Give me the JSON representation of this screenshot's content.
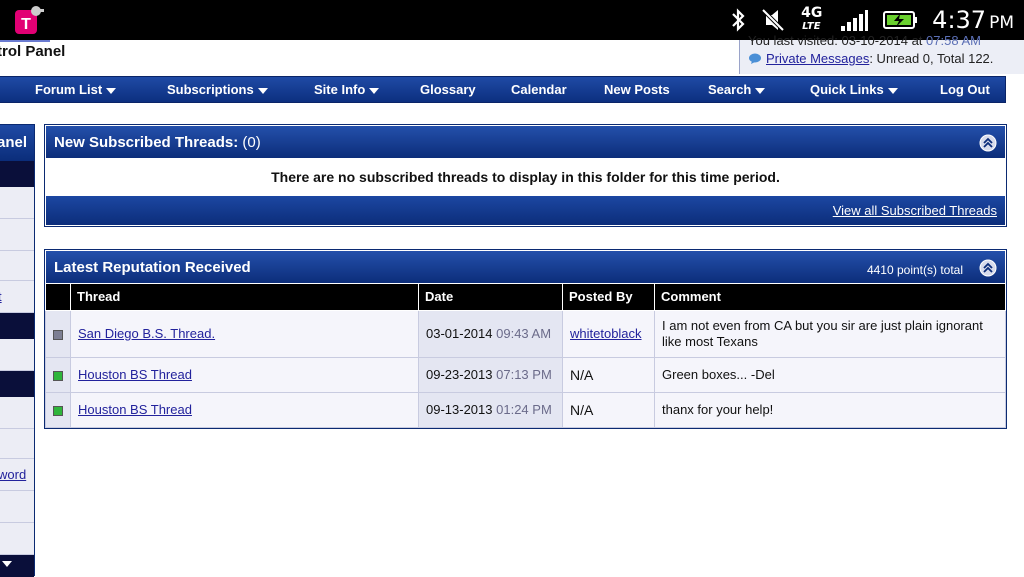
{
  "status_bar": {
    "network": "4G",
    "network_sub": "LTE",
    "time": "4:37",
    "ampm": "PM"
  },
  "header": {
    "panel_title": "trol Panel",
    "last_visited_label": "You last visited: 03-10-2014 at",
    "last_visited_time": "07:58 AM",
    "private_messages_link": "Private Messages",
    "private_messages_info": ": Unread 0, Total 122."
  },
  "navbar": {
    "items": [
      {
        "label": "Forum List",
        "dropdown": true
      },
      {
        "label": "Subscriptions",
        "dropdown": true
      },
      {
        "label": "Site Info",
        "dropdown": true
      },
      {
        "label": "Glossary",
        "dropdown": false
      },
      {
        "label": "Calendar",
        "dropdown": false
      },
      {
        "label": "New Posts",
        "dropdown": false
      },
      {
        "label": "Search",
        "dropdown": true
      },
      {
        "label": "Quick Links",
        "dropdown": true
      },
      {
        "label": "Log Out",
        "dropdown": false
      }
    ]
  },
  "sidebar": {
    "header_label": "anel",
    "link_1": "t",
    "link_2": "word"
  },
  "subscribed_threads": {
    "title": "New Subscribed Threads:",
    "count": "(0)",
    "empty_message": "There are no subscribed threads to display in this folder for this time period.",
    "view_all_link": "View all Subscribed Threads"
  },
  "reputation": {
    "title": "Latest Reputation Received",
    "points_total": "4410 point(s) total",
    "columns": {
      "thread": "Thread",
      "date": "Date",
      "posted_by": "Posted By",
      "comment": "Comment"
    },
    "rows": [
      {
        "rep_color": "#7d7f93",
        "thread": "San Diego B.S. Thread.",
        "date": "03-01-2014",
        "time": "09:43 AM",
        "posted_by": "whitetoblack",
        "posted_by_link": true,
        "comment": "I am not even from CA but you sir are just plain ignorant like most Texans"
      },
      {
        "rep_color": "#2fb53b",
        "thread": "Houston BS Thread",
        "date": "09-23-2013",
        "time": "07:13 PM",
        "posted_by": "N/A",
        "posted_by_link": false,
        "comment": "Green boxes... -Del"
      },
      {
        "rep_color": "#2fb53b",
        "thread": "Houston BS Thread",
        "date": "09-13-2013",
        "time": "01:24 PM",
        "posted_by": "N/A",
        "posted_by_link": false,
        "comment": "thanx for your help!"
      }
    ]
  },
  "colors": {
    "nav_blue": "#0c2f7f",
    "link": "#22229c"
  }
}
